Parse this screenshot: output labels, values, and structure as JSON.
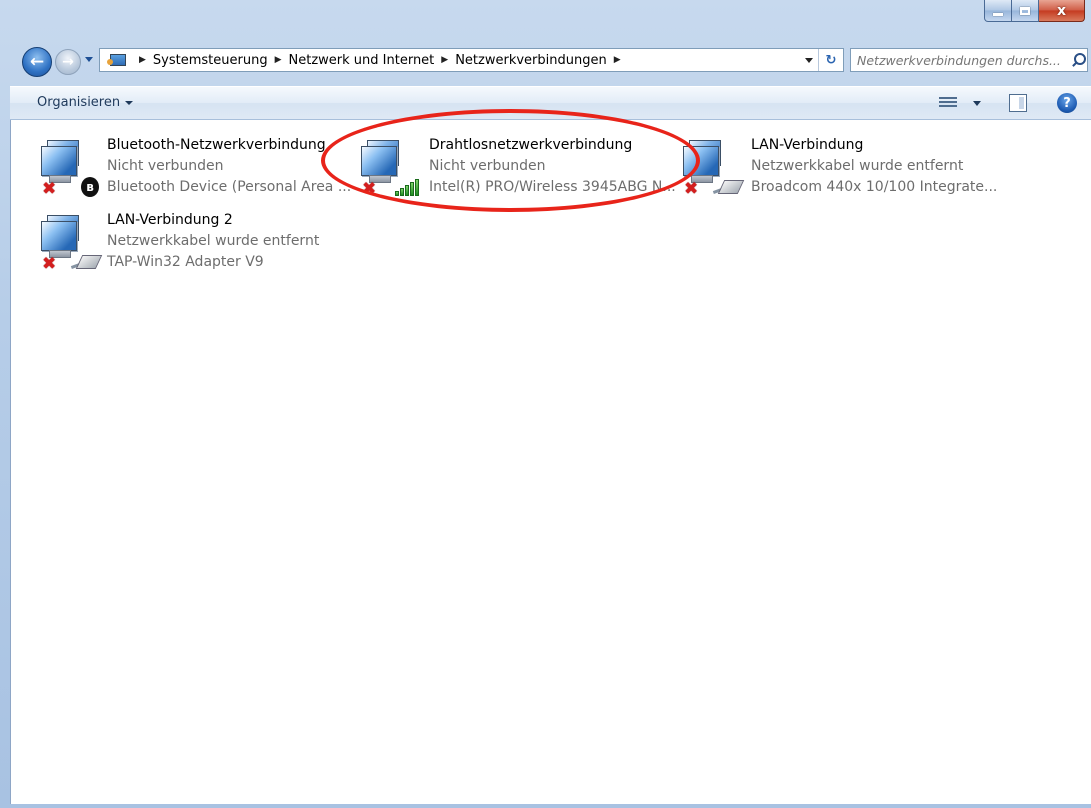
{
  "window": {
    "caption_buttons": {
      "minimize_icon": "minimize-icon",
      "maximize_icon": "maximize-icon",
      "close_glyph": "x"
    }
  },
  "navigation": {
    "back_glyph": "←",
    "forward_glyph": "→",
    "breadcrumb": [
      "Systemsteuerung",
      "Netzwerk und Internet",
      "Netzwerkverbindungen"
    ],
    "separator": "▶",
    "refresh_glyph": "↻"
  },
  "search": {
    "placeholder": "Netzwerkverbindungen durchs..."
  },
  "toolbar": {
    "organize_label": "Organisieren",
    "help_glyph": "?"
  },
  "connections": [
    {
      "name": "Bluetooth-Netzwerkverbindung",
      "status": "Nicht verbunden",
      "device": "Bluetooth Device (Personal Area ...",
      "badge": "bluetooth",
      "badge_glyph": "ʕ"
    },
    {
      "name": "Drahtlosnetzwerkverbindung",
      "status": "Nicht verbunden",
      "device": "Intel(R) PRO/Wireless 3945ABG N...",
      "badge": "wireless-signal"
    },
    {
      "name": "LAN-Verbindung",
      "status": "Netzwerkkabel wurde entfernt",
      "device": "Broadcom 440x 10/100 Integrate...",
      "badge": "network-cable"
    },
    {
      "name": "LAN-Verbindung 2",
      "status": "Netzwerkkabel wurde entfernt",
      "device": "TAP-Win32 Adapter V9",
      "badge": "network-cable"
    }
  ],
  "colors": {
    "annotation": "#e8241a",
    "disconnected_x": "#d41e1e",
    "secondary_text": "#6d6d6d"
  },
  "glyphs": {
    "disconnected": "✖",
    "bluetooth": "Ɓ"
  }
}
